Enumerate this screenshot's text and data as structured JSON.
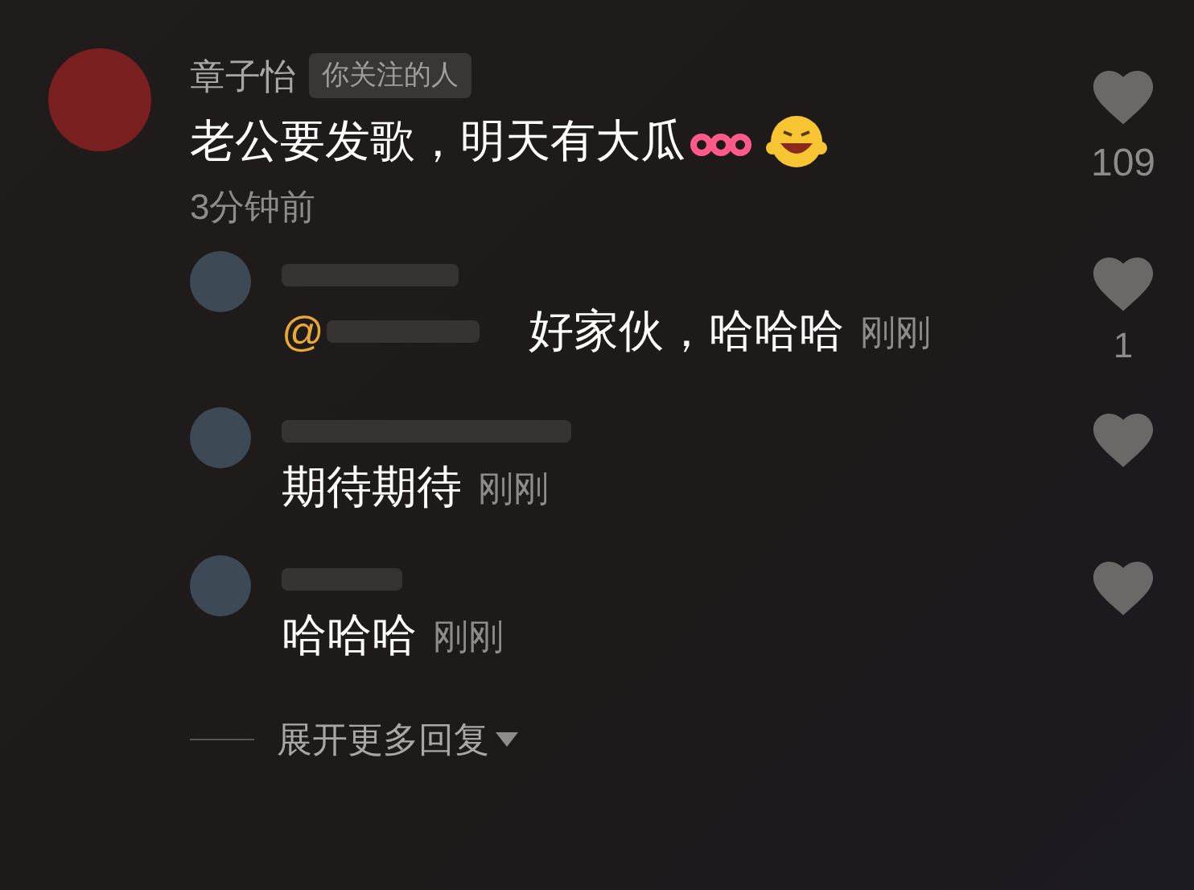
{
  "comment": {
    "author": "章子怡",
    "badge": "你关注的人",
    "text": "老公要发歌，明天有大瓜",
    "time": "3分钟前",
    "liked": false,
    "likes": "109"
  },
  "replies": [
    {
      "mention": "@",
      "text": "好家伙，哈哈哈",
      "time": "刚刚",
      "liked": false,
      "likes": "1"
    },
    {
      "text": "期待期待",
      "time": "刚刚",
      "liked": false
    },
    {
      "text": "哈哈哈",
      "time": "刚刚",
      "liked": false
    }
  ],
  "expand": {
    "label": "展开更多回复"
  }
}
